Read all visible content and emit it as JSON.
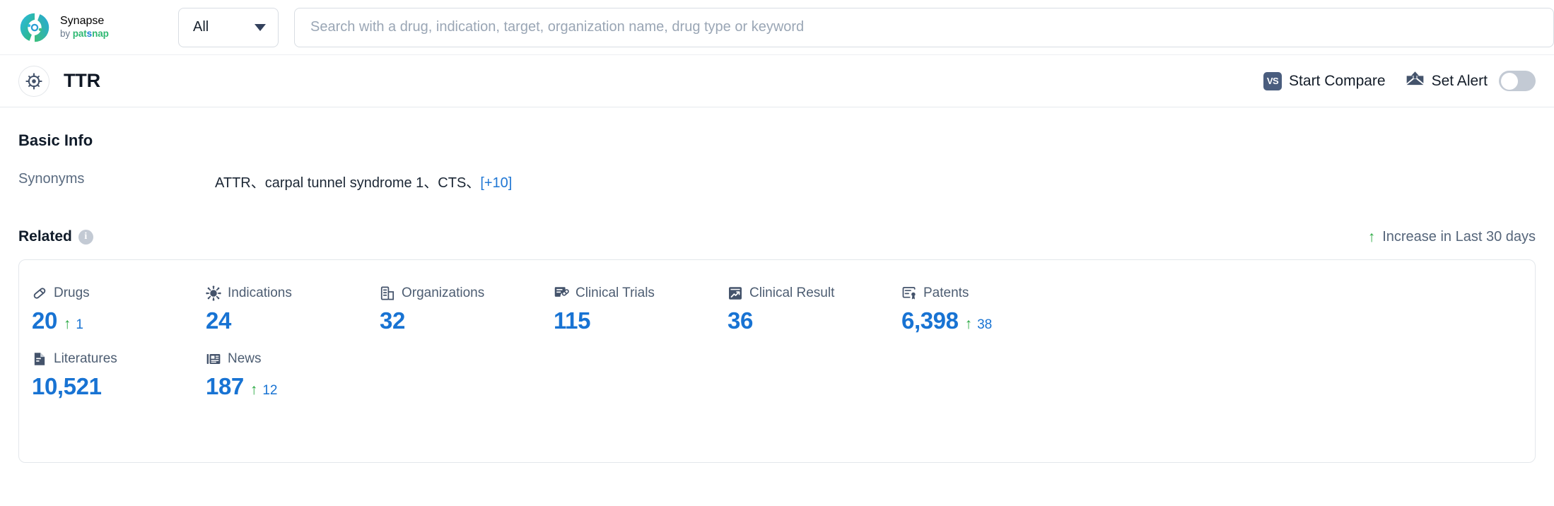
{
  "topbar": {
    "brand": {
      "name": "Synapse",
      "by": "by ",
      "pat": "pat",
      "s": "s",
      "nap": "nap"
    },
    "scope": {
      "selected": "All",
      "options": [
        "All"
      ]
    },
    "search": {
      "value": "",
      "placeholder": "Search with a drug, indication, target, organization name, drug type or keyword"
    }
  },
  "entitybar": {
    "title": "TTR",
    "start_compare": "Start Compare",
    "vs_badge": "VS",
    "set_alert": "Set Alert",
    "alert_enabled": false
  },
  "basic_info": {
    "heading": "Basic Info",
    "synonyms_label": "Synonyms",
    "synonyms_value": "ATTR、carpal tunnel syndrome 1、CTS、",
    "synonyms_more": "[+10]"
  },
  "related": {
    "heading": "Related",
    "info_glyph": "i",
    "legend_arrow": "↑",
    "legend_text": "Increase in Last 30 days",
    "stats": [
      {
        "icon": "pill-icon",
        "label": "Drugs",
        "value": "20",
        "delta": "1",
        "delta_arrow": "↑"
      },
      {
        "icon": "virus-icon",
        "label": "Indications",
        "value": "24",
        "delta": "",
        "delta_arrow": ""
      },
      {
        "icon": "building-icon",
        "label": "Organizations",
        "value": "32",
        "delta": "",
        "delta_arrow": ""
      },
      {
        "icon": "trial-doc-icon",
        "label": "Clinical Trials",
        "value": "115",
        "delta": "",
        "delta_arrow": ""
      },
      {
        "icon": "chart-result-icon",
        "label": "Clinical Result",
        "value": "36",
        "delta": "",
        "delta_arrow": ""
      },
      {
        "icon": "patent-icon",
        "label": "Patents",
        "value": "6,398",
        "delta": "38",
        "delta_arrow": "↑"
      },
      {
        "icon": "literature-icon",
        "label": "Literatures",
        "value": "10,521",
        "delta": "",
        "delta_arrow": ""
      },
      {
        "icon": "news-icon",
        "label": "News",
        "value": "187",
        "delta": "12",
        "delta_arrow": "↑"
      }
    ]
  },
  "colors": {
    "accent_blue": "#1873d3",
    "increase_green": "#2aa942",
    "label_gray": "#4d5d72",
    "badge_navy": "#4a5d7e"
  }
}
